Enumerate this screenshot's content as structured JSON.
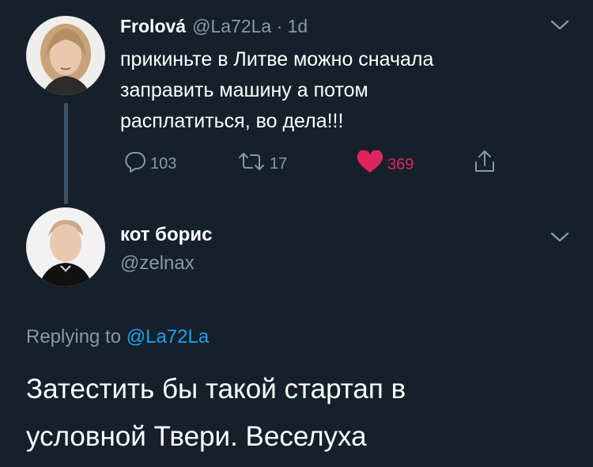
{
  "colors": {
    "background": "#15202b",
    "secondary_text": "#8899a6",
    "thread_line": "#3d5466",
    "like_active": "#e0245e",
    "link": "#1da1f2"
  },
  "tweet1": {
    "display_name": "Frolová",
    "handle_time": "@La72La · 1d",
    "text_lines": [
      "прикиньте в Литве можно сначала",
      "заправить машину а потом",
      "расплатиться, во дела!!!"
    ],
    "actions": {
      "reply_count": "103",
      "retweet_count": "17",
      "like_count": "369",
      "reply_icon": "reply-bubble-icon",
      "retweet_icon": "retweet-icon",
      "like_icon": "heart-filled-icon",
      "share_icon": "share-icon"
    }
  },
  "tweet2": {
    "display_name": "кот борис",
    "handle": "@zelnax",
    "replying_prefix": "Replying to",
    "replying_handle": "@La72La",
    "text_lines": [
      "Затестить бы такой стартап в",
      "условной Твери. Веселуха"
    ]
  }
}
